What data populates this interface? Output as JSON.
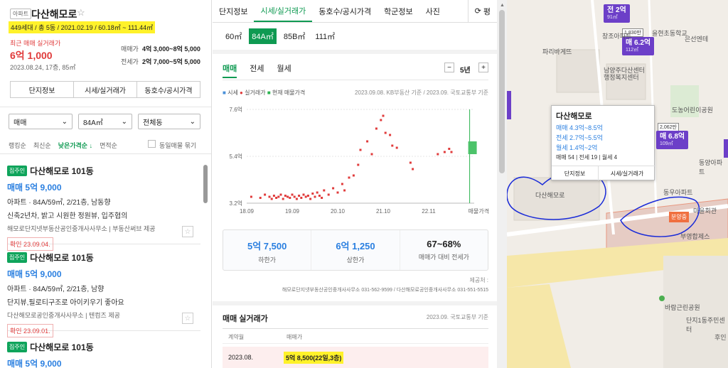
{
  "complex": {
    "badge": "아파트",
    "name": "다산해모로",
    "info": "449세대 / 총 5동 / 2021.02.19 / 60.18㎡ ~ 111.44㎡",
    "recent_label": "최근 매매 실거래가",
    "recent_price": "6억 1,000",
    "recent_detail": "2023.08.24, 17층, 85㎡",
    "sale_label": "매매가",
    "sale_value": "4억 3,000~8억 5,000",
    "jeonse_label": "전세가",
    "jeonse_value": "2억 7,000~5억 5,000"
  },
  "left_buttons": [
    "단지정보",
    "시세/실거래가",
    "동호수/공시가격"
  ],
  "filters": {
    "type": "매매",
    "area": "84A㎡",
    "dong": "전체동"
  },
  "sort": {
    "items": [
      "랭킹순",
      "최신순",
      "낮은가격순 ↓",
      "면적순"
    ],
    "same": "동일매물 묶기"
  },
  "listings": [
    {
      "tag": "집주인",
      "title": "다산해모로 101동",
      "price": "매매 5억 9,000",
      "desc": "아파트 · 84A/59㎡, 2/21층, 남동향",
      "feature": "신축2년차, 밝고 시원한 정원뷰, 입주협의",
      "source": "해모로단지넷부동산공인중개사사무소 | 부동산써브 제공",
      "confirm": "확인 23.09.04."
    },
    {
      "tag": "집주인",
      "title": "다산해모로 101동",
      "price": "매매 5억 9,000",
      "desc": "아파트 · 84A/59㎡, 2/21층, 남향",
      "feature": "단지뷰,필로티구조로 아이키우기 좋아요",
      "source": "다산해모로공인중개사사무소 | 텐컴즈 제공",
      "confirm": "확인 23.09.01."
    },
    {
      "tag": "집주인",
      "title": "다산해모로 101동",
      "price": "매매 5억 9,000",
      "desc": "",
      "feature": "",
      "source": "",
      "confirm": ""
    }
  ],
  "mid_tabs": [
    "단지정보",
    "시세/실거래가",
    "동호수/공시가격",
    "학군정보",
    "사진"
  ],
  "mid_tab_right": "평",
  "areas": [
    "60㎡",
    "84A㎡",
    "85B㎡",
    "111㎡"
  ],
  "sub_tabs": [
    "매매",
    "전세",
    "월세"
  ],
  "period": "5년",
  "legend": {
    "a": "시세",
    "b": "실거래가",
    "c": "현재 매물가격",
    "basis": "2023.09.08. KB부동산 기준 / 2023.09. 국토교통부 기준"
  },
  "chart_data": {
    "type": "scatter",
    "y_ticks": [
      "7.6억",
      "5.4억",
      "3.2억"
    ],
    "ylim": [
      3.2,
      7.6
    ],
    "x_ticks": [
      "18.09",
      "19.09",
      "20.10",
      "21.10",
      "22.11"
    ],
    "x_end": "매물가격",
    "points": [
      [
        0.02,
        3.5
      ],
      [
        0.06,
        3.45
      ],
      [
        0.08,
        3.6
      ],
      [
        0.1,
        3.5
      ],
      [
        0.11,
        3.4
      ],
      [
        0.12,
        3.55
      ],
      [
        0.13,
        3.45
      ],
      [
        0.14,
        3.5
      ],
      [
        0.15,
        3.6
      ],
      [
        0.16,
        3.4
      ],
      [
        0.17,
        3.55
      ],
      [
        0.18,
        3.5
      ],
      [
        0.19,
        3.45
      ],
      [
        0.2,
        3.6
      ],
      [
        0.21,
        3.5
      ],
      [
        0.22,
        3.4
      ],
      [
        0.23,
        3.55
      ],
      [
        0.24,
        3.45
      ],
      [
        0.25,
        3.6
      ],
      [
        0.26,
        3.5
      ],
      [
        0.27,
        3.55
      ],
      [
        0.28,
        3.4
      ],
      [
        0.29,
        3.65
      ],
      [
        0.3,
        3.5
      ],
      [
        0.31,
        3.7
      ],
      [
        0.32,
        3.55
      ],
      [
        0.33,
        3.45
      ],
      [
        0.34,
        3.8
      ],
      [
        0.36,
        3.6
      ],
      [
        0.38,
        3.9
      ],
      [
        0.4,
        3.7
      ],
      [
        0.42,
        4.1
      ],
      [
        0.43,
        3.8
      ],
      [
        0.45,
        4.4
      ],
      [
        0.47,
        4.5
      ],
      [
        0.49,
        5.0
      ],
      [
        0.5,
        5.7
      ],
      [
        0.53,
        6.1
      ],
      [
        0.55,
        5.5
      ],
      [
        0.57,
        6.7
      ],
      [
        0.59,
        7.1
      ],
      [
        0.6,
        7.3
      ],
      [
        0.61,
        6.5
      ],
      [
        0.63,
        6.4
      ],
      [
        0.64,
        5.9
      ],
      [
        0.66,
        5.8
      ],
      [
        0.72,
        5.1
      ],
      [
        0.73,
        4.8
      ],
      [
        0.84,
        5.5
      ],
      [
        0.87,
        5.6
      ],
      [
        0.89,
        5.75
      ],
      [
        0.9,
        5.6
      ]
    ],
    "current_price": {
      "x": 0.98,
      "ymin": 5.5,
      "ymax": 6.1
    }
  },
  "summary": [
    {
      "value": "5억 7,500",
      "label": "하한가"
    },
    {
      "value": "6억 1,250",
      "label": "상한가"
    },
    {
      "value": "67~68%",
      "label": "매매가 대비 전세가"
    }
  ],
  "provider_label": "제공처 :",
  "provider_text": "해모로단지넷부동산공인중개사사무소 031-562-9599 / 다산해모로공인중개사사무소 031-551-5515",
  "deals": {
    "title": "매매 실거래가",
    "basis": "2023.09. 국토교통부 기준",
    "col1": "계약월",
    "col2": "매매가",
    "rows": [
      {
        "month": "2023.08.",
        "price": "5억 8,500(22일,3층)"
      }
    ]
  },
  "map": {
    "popup_title": "다산해모로",
    "popup_sale": "매매 4.3억~8.5억",
    "popup_jeonse": "전세 2.7억~5.5억",
    "popup_rent": "월세 1.4억~2억",
    "popup_counts": "매매 54 | 전세 19 | 월세 4",
    "popup_btn1": "단지정보",
    "popup_btn2": "시세/실거래가",
    "pins": [
      {
        "title": "전 2억",
        "sub": "91㎡"
      },
      {
        "title": "매 6.2억",
        "sub": "112㎡",
        "top": "1,830만"
      },
      {
        "title": "매 6.8억",
        "sub": "109㎡",
        "top": "2,062만"
      }
    ],
    "pois": [
      "을현초동학교",
      "은선엔테",
      "파리바게뜨",
      "창조아파트",
      "남양주다산센터",
      "행정복지센터",
      "도농어린이공원",
      "동양아파트",
      "다산해모로",
      "동우아파트",
      "바람근린공원",
      "단지1동주민센터",
      "마을회관",
      "부영합제스",
      "후인",
      "분양중"
    ]
  }
}
